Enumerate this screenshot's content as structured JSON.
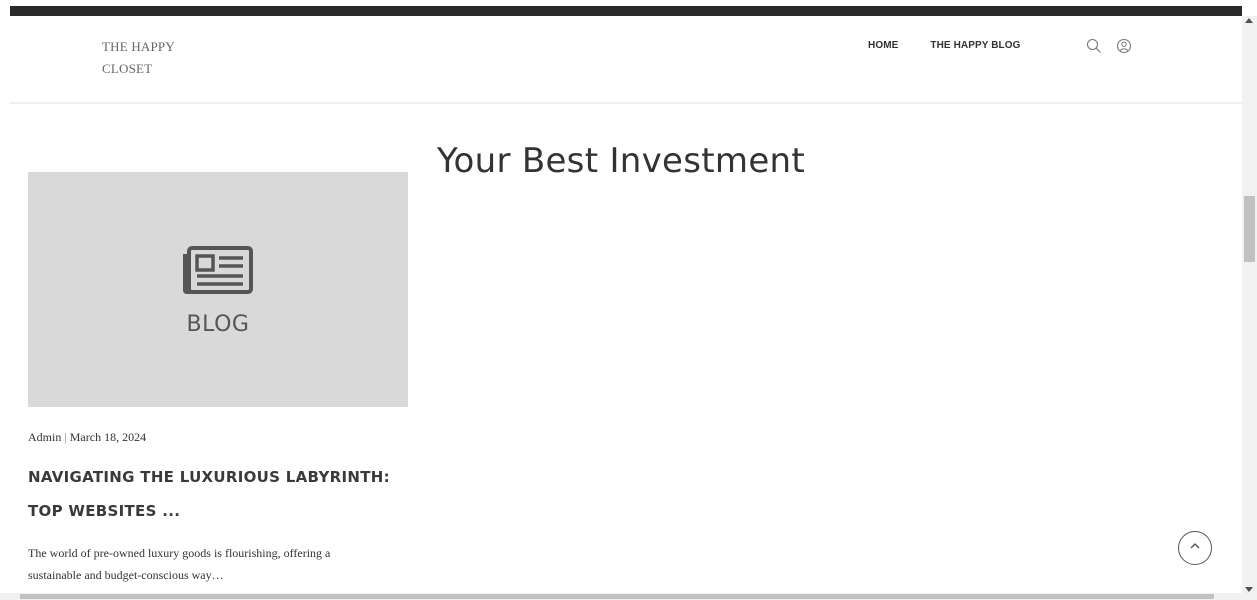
{
  "site": {
    "logo_text": "THE HAPPY CLOSET",
    "nav": [
      "HOME",
      "THE HAPPY BLOG"
    ],
    "icons": [
      "search-icon",
      "user-icon"
    ]
  },
  "page": {
    "title": "Your Best Investment"
  },
  "post": {
    "image_label": "BLOG",
    "image_icon": "newspaper-icon",
    "author": "Admin",
    "separator": "|",
    "date": "March 18, 2024",
    "title": "NAVIGATING THE LUXURIOUS LABYRINTH: TOP WEBSITES ...",
    "excerpt": "The world of pre-owned luxury goods is flourishing, offering a sustainable and budget-conscious way…"
  },
  "ui": {
    "scroll_top_icon": "chevron-up-icon"
  }
}
